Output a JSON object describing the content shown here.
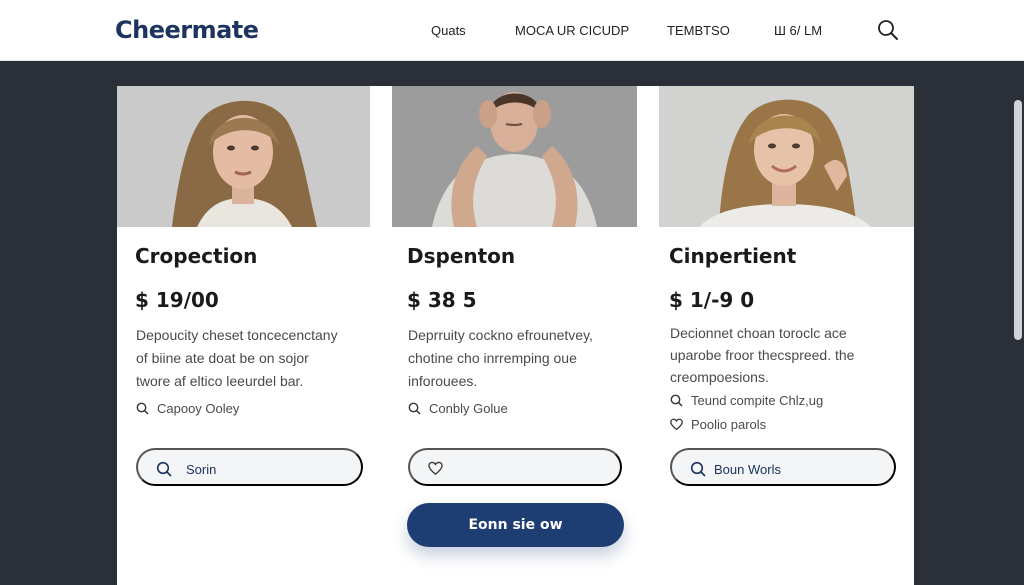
{
  "header": {
    "logo": "Cheermate",
    "nav": [
      "Quats",
      "MOCA UR  CICUDP",
      "TEMBTSO",
      "Ш  6/ LM"
    ],
    "search_icon": "search-icon"
  },
  "cards": [
    {
      "title": "Cropection",
      "price": "$ 19/00",
      "desc": [
        "Depoucity cheset toncecenctany",
        "of biine ate doat be on sojor",
        "twore af eltico leeurdel bar."
      ],
      "meta": [
        {
          "icon": "search-icon",
          "text": "Capooy  Ooley"
        }
      ],
      "pill": {
        "icon": "search-icon",
        "label": "Sorin"
      }
    },
    {
      "title": "Dspenton",
      "price": "$ 38 5",
      "desc": [
        "Deprruity cockno efrounetvey,",
        "chotine cho inrremping oue",
        "inforouees."
      ],
      "meta": [
        {
          "icon": "search-icon",
          "text": "Conbly  Golue"
        }
      ],
      "pill": {
        "icon": "heart-icon",
        "label": ""
      }
    },
    {
      "title": "Cinpertient",
      "price": "$ 1/-9 0",
      "desc": [
        "Decionnet choan toroclc ace",
        "uparobe froor thecspreed. the",
        "creompoesions."
      ],
      "meta": [
        {
          "icon": "search-icon",
          "text": "Teund compite Chlz,ug"
        },
        {
          "icon": "heart-icon",
          "text": "Poolio parols"
        }
      ],
      "pill": {
        "icon": "search-icon",
        "label": "Boun Worls"
      }
    }
  ],
  "cta": {
    "label": "Eonn sie ow"
  },
  "colors": {
    "brand": "#1d3461",
    "cta": "#1d3d73",
    "backdrop": "#2b2f38"
  }
}
